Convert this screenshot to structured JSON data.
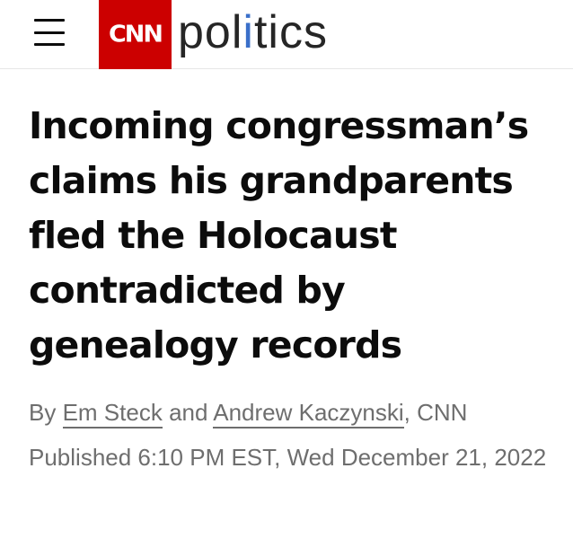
{
  "header": {
    "menu_icon": "hamburger-menu-icon",
    "logo_text": "CNN",
    "section_before": "pol",
    "section_accent": "i",
    "section_after": "tics",
    "brand_color": "#cc0000",
    "accent_color": "#3a6fc9"
  },
  "article": {
    "headline": "Incoming congressman’s claims his grandparents fled the Holocaust contradicted by genealogy records",
    "byline": {
      "prefix": "By",
      "author1": "Em Steck",
      "conjunction": "and",
      "author2": "Andrew Kaczynski",
      "suffix": ", CNN"
    },
    "published": "Published 6:10 PM EST, Wed December 21, 2022"
  }
}
